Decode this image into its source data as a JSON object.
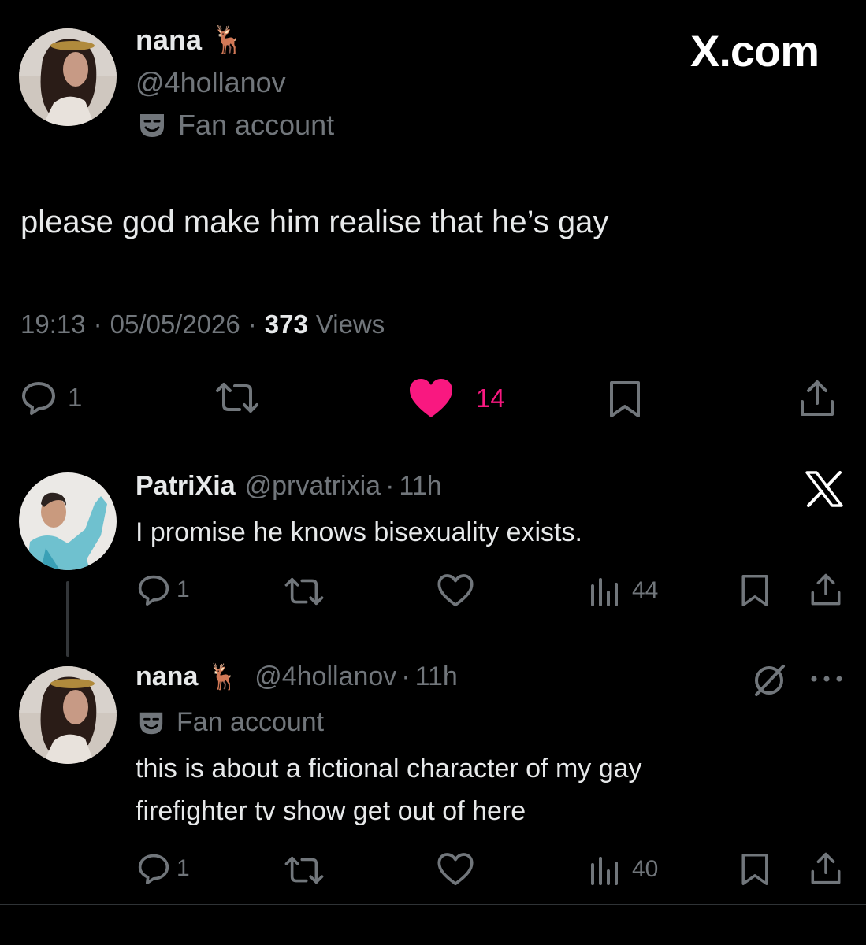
{
  "main_tweet": {
    "author_name": "nana",
    "author_emoji": "🦌",
    "handle": "@4hollanov",
    "label_icon": "theater-mask-icon",
    "label": "Fan account",
    "watermark": "X.com",
    "text": "please god make him realise that he’s gay",
    "time": "19:13",
    "separator": "·",
    "date": "05/05/2026",
    "views_count": "373",
    "views_label": "Views",
    "actions": {
      "replies": "1",
      "likes": "14",
      "like_color": "#f91880"
    }
  },
  "replies": [
    {
      "author_name": "PatriXia",
      "handle": "@prvatrixia",
      "separator": "·",
      "time": "11h",
      "text": "I promise he knows bisexuality exists.",
      "corner_icon": "x-logo-icon",
      "actions": {
        "replies": "1",
        "views": "44"
      }
    },
    {
      "author_name": "nana",
      "author_emoji": "🦌",
      "handle": "@4hollanov",
      "separator": "·",
      "time": "11h",
      "label_icon": "theater-mask-icon",
      "label": "Fan account",
      "text_line1": "this is about a fictional character of my gay",
      "text_line2": "firefighter tv show get out of here",
      "corner_icon": "grok-icon",
      "more_icon": "more-dots-icon",
      "actions": {
        "replies": "1",
        "views": "40"
      }
    }
  ],
  "colors": {
    "background": "#000000",
    "text": "#e7e9ea",
    "muted": "#71767b",
    "like": "#f91880",
    "divider": "#2f3336"
  }
}
